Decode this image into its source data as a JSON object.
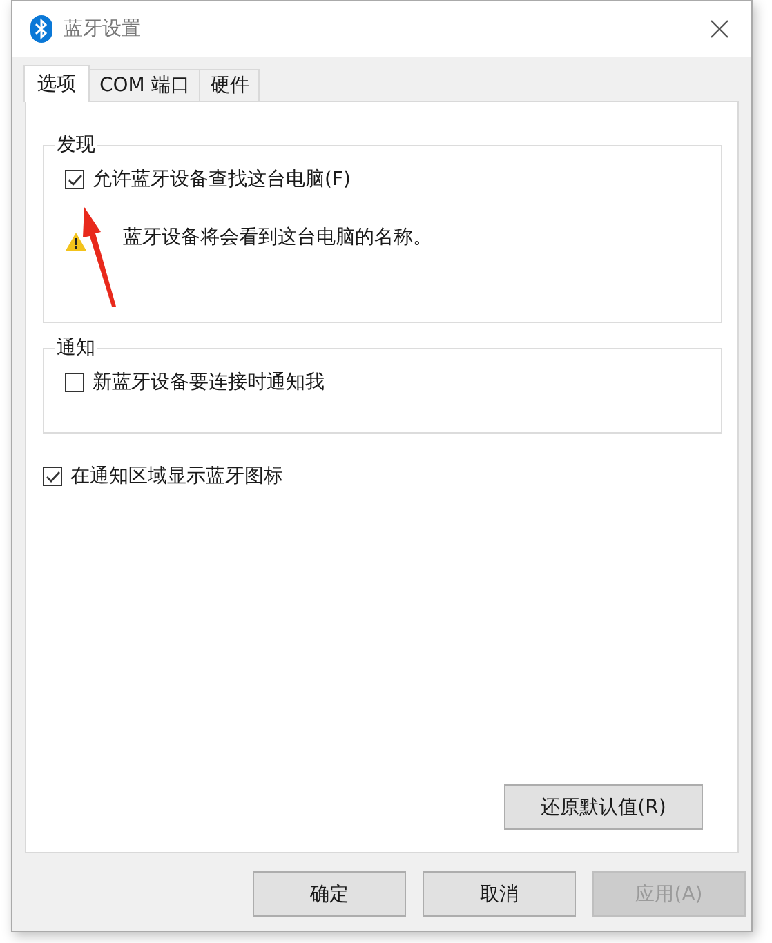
{
  "window": {
    "title": "蓝牙设置"
  },
  "tabs": [
    {
      "label": "选项",
      "selected": true
    },
    {
      "label": "COM 端口",
      "selected": false
    },
    {
      "label": "硬件",
      "selected": false
    }
  ],
  "groups": [
    {
      "title": "发现",
      "options": [
        {
          "label": "允许蓝牙设备查找这台电脑(F)",
          "checked": true
        }
      ],
      "warning": "蓝牙设备将会看到这台电脑的名称。"
    },
    {
      "title": "通知",
      "options": [
        {
          "label": "新蓝牙设备要连接时通知我",
          "checked": false
        }
      ]
    }
  ],
  "show_icon_option": {
    "label": "在通知区域显示蓝牙图标",
    "checked": true
  },
  "restore_button": "还原默认值(R)",
  "buttons": [
    {
      "label": "确定",
      "disabled": false
    },
    {
      "label": "取消",
      "disabled": false
    },
    {
      "label": "应用(A)",
      "disabled": true
    }
  ]
}
